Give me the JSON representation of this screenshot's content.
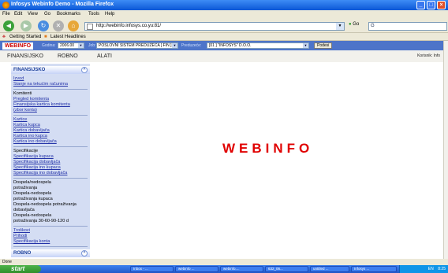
{
  "window": {
    "title": "Infosys Webinfo Demo - Mozilla Firefox"
  },
  "menu": [
    "File",
    "Edit",
    "View",
    "Go",
    "Bookmarks",
    "Tools",
    "Help"
  ],
  "address": {
    "url": "http://webinfo.infosys.co.yu:81/",
    "go_label": "Go"
  },
  "bookmarks": [
    "Getting Started",
    "Latest Headlines"
  ],
  "app": {
    "logo": "WEBINFO",
    "godina_label": "Godina:",
    "godina_value": "2006.00",
    "job_label": "Job:",
    "job_value": "POSLOVNI SISTEM PREDUZECA [ FIN ]",
    "preduzece_label": "Preduzeće:",
    "preduzece_value": "[01 ] \"INFOSYS\" D.O.O.",
    "podesi_label": "Podesi"
  },
  "tabs": [
    "FINANSIJSKO",
    "ROBNO",
    "ALATI"
  ],
  "user_info": "Korisnik: Info",
  "sidebar": {
    "section1_title": "FINANSIJSKO",
    "section2_title": "ROBNO",
    "groups": [
      {
        "items": [
          {
            "t": "Izvod",
            "link": true
          },
          {
            "t": "Stanje na tekućim računima",
            "link": true
          }
        ]
      },
      {
        "items": [
          {
            "t": "Komitenti",
            "link": false
          },
          {
            "t": "Pregled komitenta",
            "link": true
          },
          {
            "t": "Finansijska kartica komitenta",
            "link": true
          },
          {
            "t": "(zbor konta)",
            "link": true
          }
        ]
      },
      {
        "items": [
          {
            "t": "Kartice",
            "link": true
          },
          {
            "t": "Kartica kupca",
            "link": true
          },
          {
            "t": "Kartica dobavljača",
            "link": true
          },
          {
            "t": "Kartica ino kupca",
            "link": true
          },
          {
            "t": "Kartica ino dobavljača",
            "link": true
          }
        ]
      },
      {
        "items": [
          {
            "t": "Specifikacije",
            "link": false
          },
          {
            "t": "Specifikacija kupaca",
            "link": true
          },
          {
            "t": "Specifikacija dobavljača",
            "link": true
          },
          {
            "t": "Specifikacija ino kupaca",
            "link": true
          },
          {
            "t": "Specifikacija ino dobavljača",
            "link": true
          }
        ]
      },
      {
        "items": [
          {
            "t": "Dospela/nedospela",
            "link": false
          },
          {
            "t": "potraživanja",
            "link": false
          },
          {
            "t": "Dospela-nedospela",
            "link": false
          },
          {
            "t": "potraživanja kupaca",
            "link": false
          },
          {
            "t": "Dospela-nedospela potraživanja",
            "link": false
          },
          {
            "t": "dobavljača",
            "link": false
          },
          {
            "t": "Dospela-nedospela",
            "link": false
          },
          {
            "t": "potraživanja 30-60-90-120 d",
            "link": false
          }
        ]
      },
      {
        "items": [
          {
            "t": "Troškovi",
            "link": true
          },
          {
            "t": "Prihodi",
            "link": true
          },
          {
            "t": "Specifikacija konta",
            "link": true
          }
        ]
      }
    ]
  },
  "content": {
    "brand": "WEBINFO"
  },
  "status": "Done",
  "taskbar": {
    "start": "start",
    "tasks": [
      "Inbox - ...",
      "webinfo ...",
      "webinfo....",
      "632_06...",
      "untitled ...",
      "Infosys ..."
    ],
    "clock": "8:25",
    "lang": "EN"
  },
  "colors": {
    "brand_red": "#e00000",
    "app_bar": "#4d74c9",
    "sidebar_bg": "#d4ddf3",
    "link": "#2332a8"
  }
}
